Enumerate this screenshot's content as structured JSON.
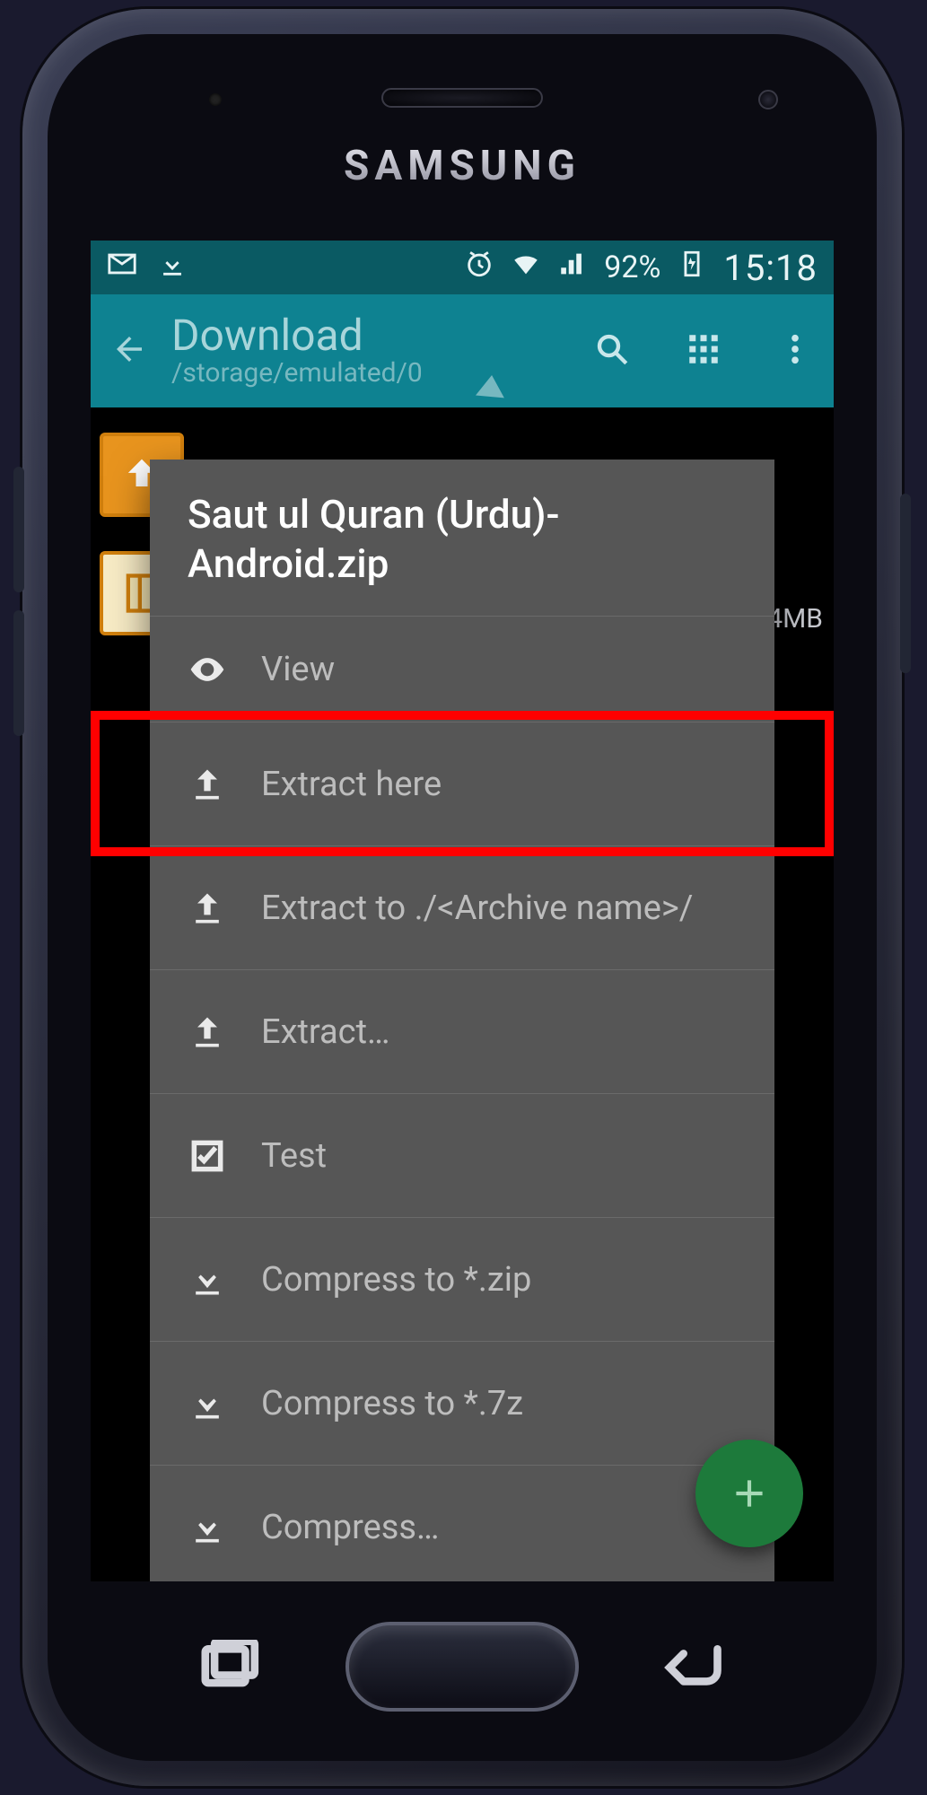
{
  "device": {
    "brand": "SAMSUNG"
  },
  "status": {
    "battery": "92%",
    "clock": "15:18"
  },
  "appbar": {
    "title": "Download",
    "subtitle": "/storage/emulated/0"
  },
  "background": {
    "file_size_hint": "4MB"
  },
  "dialog": {
    "title": "Saut ul Quran (Urdu)-Android.zip",
    "items": {
      "view": "View",
      "extract_here": "Extract here",
      "extract_to": "Extract to ./<Archive name>/",
      "extract": "Extract…",
      "test": "Test",
      "compress_zip": "Compress to *.zip",
      "compress_7z": "Compress to *.7z",
      "compress": "Compress…"
    }
  },
  "highlight": "extract_here"
}
